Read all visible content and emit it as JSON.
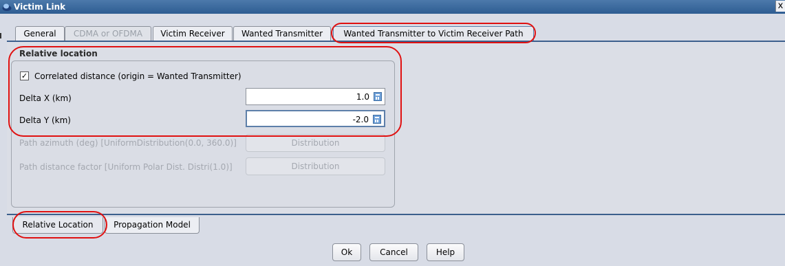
{
  "window": {
    "title": "Victim Link",
    "close_label": "x"
  },
  "tabs": [
    {
      "label": "General",
      "state": "normal"
    },
    {
      "label": "CDMA or OFDMA",
      "state": "disabled"
    },
    {
      "label": "Victim Receiver",
      "state": "normal"
    },
    {
      "label": "Wanted Transmitter",
      "state": "normal"
    },
    {
      "label": "Wanted Transmitter to Victim Receiver Path",
      "state": "active"
    }
  ],
  "relative_location": {
    "title": "Relative location",
    "correlated_label": "Correlated distance (origin = Wanted Transmitter)",
    "correlated_checked": true,
    "delta_x_label": "Delta X (km)",
    "delta_x_value": "1.0",
    "delta_y_label": "Delta Y (km)",
    "delta_y_value": "-2.0",
    "path_azimuth_label": "Path azimuth (deg) [UniformDistribution(0.0, 360.0)]",
    "path_azimuth_button": "Distribution",
    "path_distance_label": "Path distance factor [Uniform Polar Dist. Distri(1.0)]",
    "path_distance_button": "Distribution"
  },
  "bottom_tabs": [
    {
      "label": "Relative Location",
      "state": "active"
    },
    {
      "label": "Propagation Model",
      "state": "normal"
    }
  ],
  "buttons": {
    "ok": "Ok",
    "cancel": "Cancel",
    "help": "Help"
  },
  "colors": {
    "titlebar": "#2e5d92",
    "annotation": "#e01010"
  }
}
